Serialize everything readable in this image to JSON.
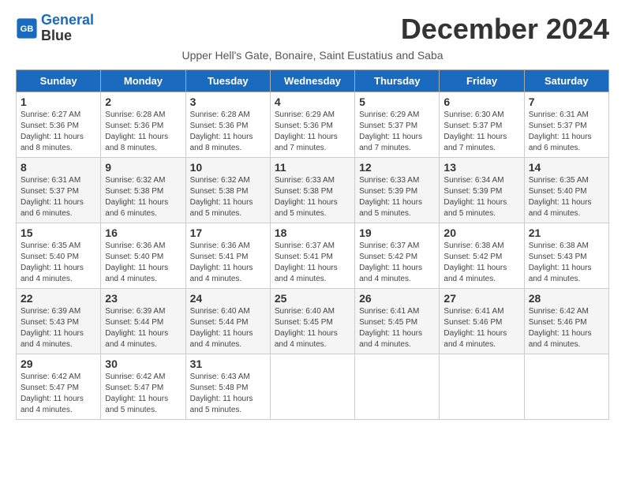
{
  "header": {
    "logo_line1": "General",
    "logo_line2": "Blue",
    "title": "December 2024",
    "subtitle": "Upper Hell's Gate, Bonaire, Saint Eustatius and Saba"
  },
  "weekdays": [
    "Sunday",
    "Monday",
    "Tuesday",
    "Wednesday",
    "Thursday",
    "Friday",
    "Saturday"
  ],
  "weeks": [
    [
      {
        "day": "1",
        "sunrise": "6:27 AM",
        "sunset": "5:36 PM",
        "daylight": "11 hours and 8 minutes."
      },
      {
        "day": "2",
        "sunrise": "6:28 AM",
        "sunset": "5:36 PM",
        "daylight": "11 hours and 8 minutes."
      },
      {
        "day": "3",
        "sunrise": "6:28 AM",
        "sunset": "5:36 PM",
        "daylight": "11 hours and 8 minutes."
      },
      {
        "day": "4",
        "sunrise": "6:29 AM",
        "sunset": "5:36 PM",
        "daylight": "11 hours and 7 minutes."
      },
      {
        "day": "5",
        "sunrise": "6:29 AM",
        "sunset": "5:37 PM",
        "daylight": "11 hours and 7 minutes."
      },
      {
        "day": "6",
        "sunrise": "6:30 AM",
        "sunset": "5:37 PM",
        "daylight": "11 hours and 7 minutes."
      },
      {
        "day": "7",
        "sunrise": "6:31 AM",
        "sunset": "5:37 PM",
        "daylight": "11 hours and 6 minutes."
      }
    ],
    [
      {
        "day": "8",
        "sunrise": "6:31 AM",
        "sunset": "5:37 PM",
        "daylight": "11 hours and 6 minutes."
      },
      {
        "day": "9",
        "sunrise": "6:32 AM",
        "sunset": "5:38 PM",
        "daylight": "11 hours and 6 minutes."
      },
      {
        "day": "10",
        "sunrise": "6:32 AM",
        "sunset": "5:38 PM",
        "daylight": "11 hours and 5 minutes."
      },
      {
        "day": "11",
        "sunrise": "6:33 AM",
        "sunset": "5:38 PM",
        "daylight": "11 hours and 5 minutes."
      },
      {
        "day": "12",
        "sunrise": "6:33 AM",
        "sunset": "5:39 PM",
        "daylight": "11 hours and 5 minutes."
      },
      {
        "day": "13",
        "sunrise": "6:34 AM",
        "sunset": "5:39 PM",
        "daylight": "11 hours and 5 minutes."
      },
      {
        "day": "14",
        "sunrise": "6:35 AM",
        "sunset": "5:40 PM",
        "daylight": "11 hours and 4 minutes."
      }
    ],
    [
      {
        "day": "15",
        "sunrise": "6:35 AM",
        "sunset": "5:40 PM",
        "daylight": "11 hours and 4 minutes."
      },
      {
        "day": "16",
        "sunrise": "6:36 AM",
        "sunset": "5:40 PM",
        "daylight": "11 hours and 4 minutes."
      },
      {
        "day": "17",
        "sunrise": "6:36 AM",
        "sunset": "5:41 PM",
        "daylight": "11 hours and 4 minutes."
      },
      {
        "day": "18",
        "sunrise": "6:37 AM",
        "sunset": "5:41 PM",
        "daylight": "11 hours and 4 minutes."
      },
      {
        "day": "19",
        "sunrise": "6:37 AM",
        "sunset": "5:42 PM",
        "daylight": "11 hours and 4 minutes."
      },
      {
        "day": "20",
        "sunrise": "6:38 AM",
        "sunset": "5:42 PM",
        "daylight": "11 hours and 4 minutes."
      },
      {
        "day": "21",
        "sunrise": "6:38 AM",
        "sunset": "5:43 PM",
        "daylight": "11 hours and 4 minutes."
      }
    ],
    [
      {
        "day": "22",
        "sunrise": "6:39 AM",
        "sunset": "5:43 PM",
        "daylight": "11 hours and 4 minutes."
      },
      {
        "day": "23",
        "sunrise": "6:39 AM",
        "sunset": "5:44 PM",
        "daylight": "11 hours and 4 minutes."
      },
      {
        "day": "24",
        "sunrise": "6:40 AM",
        "sunset": "5:44 PM",
        "daylight": "11 hours and 4 minutes."
      },
      {
        "day": "25",
        "sunrise": "6:40 AM",
        "sunset": "5:45 PM",
        "daylight": "11 hours and 4 minutes."
      },
      {
        "day": "26",
        "sunrise": "6:41 AM",
        "sunset": "5:45 PM",
        "daylight": "11 hours and 4 minutes."
      },
      {
        "day": "27",
        "sunrise": "6:41 AM",
        "sunset": "5:46 PM",
        "daylight": "11 hours and 4 minutes."
      },
      {
        "day": "28",
        "sunrise": "6:42 AM",
        "sunset": "5:46 PM",
        "daylight": "11 hours and 4 minutes."
      }
    ],
    [
      {
        "day": "29",
        "sunrise": "6:42 AM",
        "sunset": "5:47 PM",
        "daylight": "11 hours and 4 minutes."
      },
      {
        "day": "30",
        "sunrise": "6:42 AM",
        "sunset": "5:47 PM",
        "daylight": "11 hours and 5 minutes."
      },
      {
        "day": "31",
        "sunrise": "6:43 AM",
        "sunset": "5:48 PM",
        "daylight": "11 hours and 5 minutes."
      },
      null,
      null,
      null,
      null
    ]
  ],
  "labels": {
    "sunrise": "Sunrise:",
    "sunset": "Sunset:",
    "daylight": "Daylight:"
  }
}
